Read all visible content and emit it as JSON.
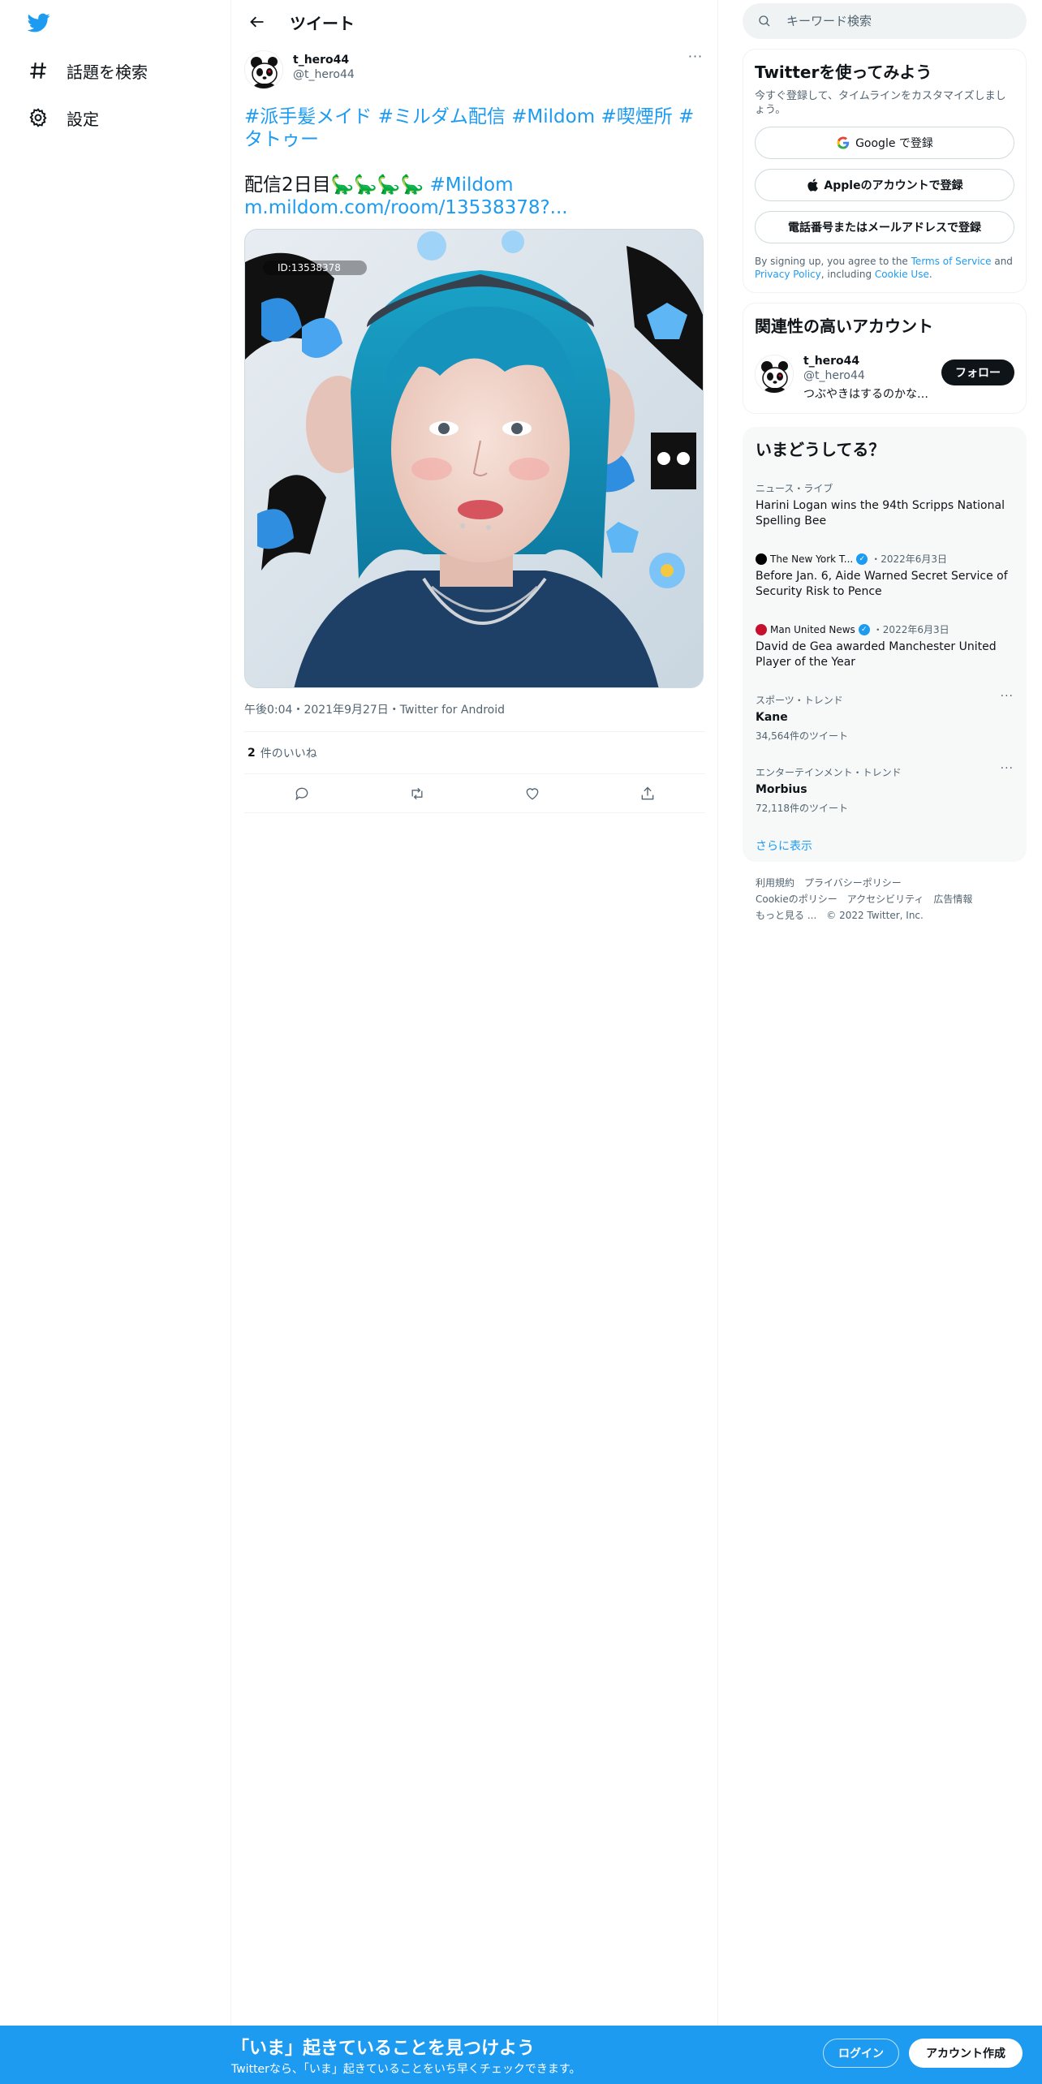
{
  "nav": {
    "explore_label": "話題を検索",
    "settings_label": "設定"
  },
  "header": {
    "title": "ツイート"
  },
  "tweet": {
    "user_name": "t_hero44",
    "user_handle": "@t_hero44",
    "hashtags_line": "#派手髪メイド #ミルダム配信 #Mildom #喫煙所 #タトゥー",
    "body_text": "配信2日目",
    "dinos": "🦕🦕🦕🦕",
    "body_hashtag": "#Mildom",
    "body_link": "m.mildom.com/room/13538378?...",
    "media_watermark": "ID:13538378",
    "timestamp": "午後0:04・2021年9月27日・",
    "source": "Twitter for Android",
    "likes_count": "2",
    "likes_label": "件のいいね"
  },
  "search": {
    "placeholder": "キーワード検索"
  },
  "signup": {
    "title": "Twitterを使ってみよう",
    "subtitle": "今すぐ登録して、タイムラインをカスタマイズしましょう。",
    "google_button": "Google で登録",
    "apple_button": "Appleのアカウントで登録",
    "phone_button": "電話番号またはメールアドレスで登録",
    "legal_prefix": "By signing up, you agree to the ",
    "terms_link": "Terms of Service",
    "legal_and": " and ",
    "privacy_link": "Privacy Policy",
    "legal_including": ", including ",
    "cookie_link": "Cookie Use",
    "legal_end": "."
  },
  "who_to_follow": {
    "title": "関連性の高いアカウント",
    "name": "t_hero44",
    "handle": "@t_hero44",
    "bio": "つぶやきはするのかな…",
    "follow_label": "フォロー"
  },
  "trends": {
    "title": "いまどうしてる？",
    "items": [
      {
        "category": "ニュース・ライブ",
        "title": "Harini Logan wins the 94th Scripps National Spelling Bee"
      },
      {
        "source": "The New York T...",
        "date": "・2022年6月3日",
        "title": "Before Jan. 6, Aide Warned Secret Service of Security Risk to Pence"
      },
      {
        "source": "Man United News",
        "date": "・2022年6月3日",
        "title": "David de Gea awarded Manchester United Player of the Year"
      },
      {
        "category": "スポーツ・トレンド",
        "title": "Kane",
        "count": "34,564件のツイート"
      },
      {
        "category": "エンターテインメント・トレンド",
        "title": "Morbius",
        "count": "72,118件のツイート"
      }
    ],
    "show_more": "さらに表示"
  },
  "footer": {
    "terms": "利用規約",
    "privacy": "プライバシーポリシー",
    "cookie": "Cookieのポリシー",
    "accessibility": "アクセシビリティ",
    "ads": "広告情報",
    "more": "もっと見る ...",
    "copyright": "© 2022 Twitter, Inc."
  },
  "banner": {
    "title": "「いま」起きていることを見つけよう",
    "subtitle": "Twitterなら、「いま」起きていることをいち早くチェックできます。",
    "login": "ログイン",
    "signup": "アカウント作成"
  },
  "colors": {
    "brand": "#1d9bf0",
    "text": "#0f1419",
    "muted": "#536471",
    "banner": "#1d9bf0"
  }
}
